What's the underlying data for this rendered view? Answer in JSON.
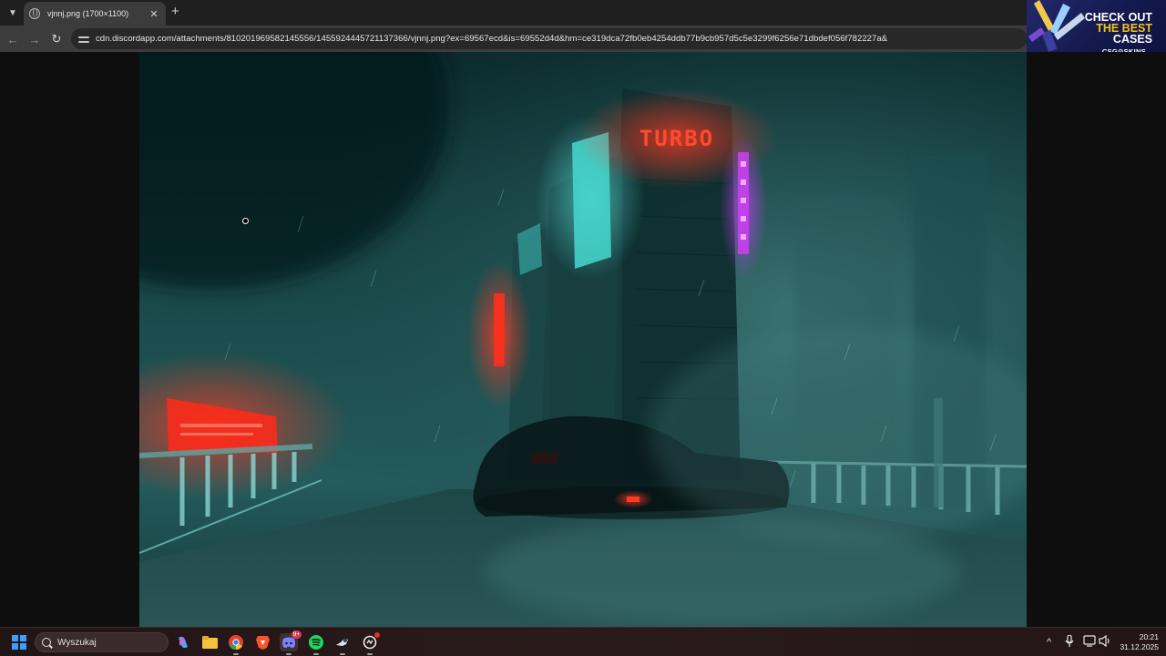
{
  "browser": {
    "tab_menu_icon": "chevron-down-icon",
    "tab": {
      "title": "vjnnj.png (1700×1100)",
      "close_glyph": "✕",
      "favicon": "globe-icon"
    },
    "new_tab_glyph": "+",
    "nav": {
      "back_glyph": "←",
      "forward_glyph": "→",
      "reload_glyph": "↻"
    },
    "address": "cdn.discordapp.com/attachments/810201969582145556/1455924445721137366/vjnnj.png?ex=69567ecd&is=69552d4d&hm=ce319dca72fb0eb4254ddb77b9cb957d5c5e3299f6256e71dbdef056f782227a&"
  },
  "ad": {
    "line1": "CHECK OUT",
    "line2": "THE BEST",
    "line3": "CASES",
    "brand": "CSG⊙SKINS"
  },
  "image_viewer": {
    "artwork": {
      "description_icon": "image-icon",
      "signs": [
        "TURBO"
      ]
    }
  },
  "taskbar": {
    "search_placeholder": "Wyszukaj",
    "apps": [
      {
        "name": "copilot",
        "icon": "copilot-icon"
      },
      {
        "name": "file-explorer",
        "icon": "folder-icon"
      },
      {
        "name": "chrome",
        "icon": "chrome-icon"
      },
      {
        "name": "brave",
        "icon": "brave-icon"
      },
      {
        "name": "discord",
        "icon": "discord-icon",
        "badge": "9+"
      },
      {
        "name": "spotify",
        "icon": "spotify-icon"
      },
      {
        "name": "steam",
        "icon": "steam-icon"
      },
      {
        "name": "app-9",
        "icon": "app-icon"
      }
    ],
    "tray": {
      "chevron": "^",
      "mic": "🎙",
      "volume": "🔊"
    },
    "clock": {
      "time": "20:21",
      "date": "31.12.2025"
    }
  },
  "colors": {
    "scene_base": "#1d4f50",
    "neon_red": "#ff2a1a",
    "neon_cyan": "#4ee0d8",
    "neon_magenta": "#d23aff",
    "ad_accent": "#f5c518"
  }
}
